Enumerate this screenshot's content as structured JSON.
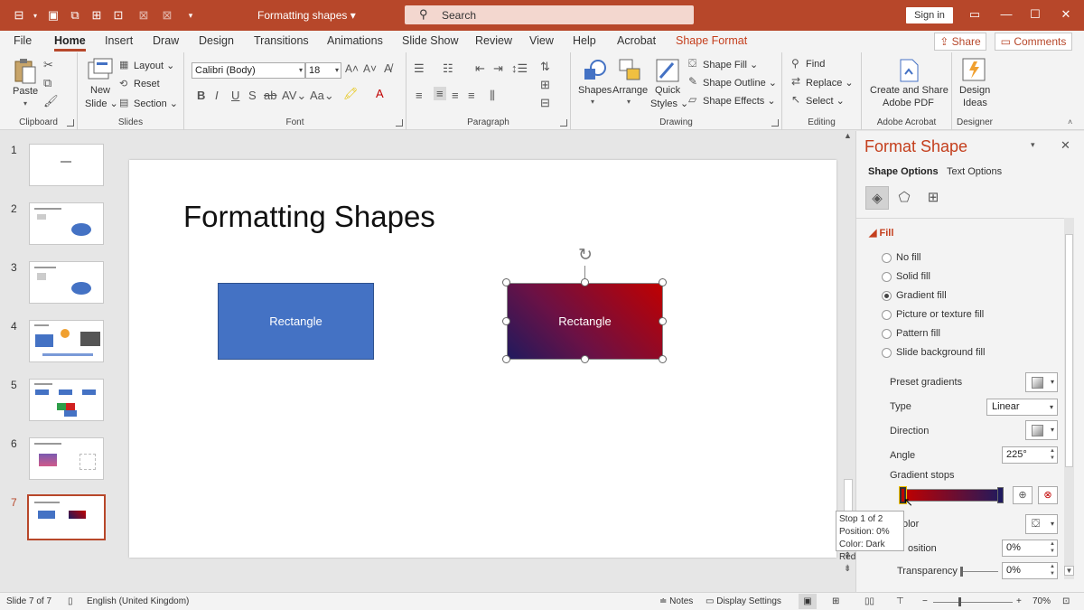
{
  "titlebar": {
    "doc_title": "Formatting shapes ▾",
    "search_label": "Search",
    "signin_label": "Sign in"
  },
  "tabs": [
    "File",
    "Home",
    "Insert",
    "Draw",
    "Design",
    "Transitions",
    "Animations",
    "Slide Show",
    "Review",
    "View",
    "Help",
    "Acrobat",
    "Shape Format"
  ],
  "share_label": "Share",
  "comments_label": "Comments",
  "ribbon": {
    "clipboard": {
      "paste": "Paste",
      "label": "Clipboard"
    },
    "slides": {
      "new_slide_1": "New",
      "new_slide_2": "Slide ⌄",
      "layout": "Layout ⌄",
      "reset": "Reset",
      "section": "Section ⌄",
      "label": "Slides"
    },
    "font": {
      "font_name": "Calibri (Body)",
      "font_size": "18",
      "label": "Font"
    },
    "paragraph": {
      "label": "Paragraph"
    },
    "drawing": {
      "shapes": "Shapes",
      "arrange": "Arrange",
      "quick_styles_1": "Quick",
      "quick_styles_2": "Styles ⌄",
      "shape_fill": "Shape Fill ⌄",
      "shape_outline": "Shape Outline ⌄",
      "shape_effects": "Shape Effects ⌄",
      "label": "Drawing"
    },
    "editing": {
      "find": "Find",
      "replace": "Replace ⌄",
      "select": "Select ⌄",
      "label": "Editing"
    },
    "acrobat": {
      "line1": "Create and Share",
      "line2": "Adobe PDF",
      "label": "Adobe Acrobat"
    },
    "designer": {
      "line1": "Design",
      "line2": "Ideas",
      "label": "Designer"
    }
  },
  "thumbnails": [
    {
      "num": "1"
    },
    {
      "num": "2"
    },
    {
      "num": "3"
    },
    {
      "num": "4"
    },
    {
      "num": "5"
    },
    {
      "num": "6"
    },
    {
      "num": "7"
    }
  ],
  "slide": {
    "title": "Formatting Shapes",
    "rect1_label": "Rectangle",
    "rect2_label": "Rectangle",
    "rect1_color": "#4472c4"
  },
  "format_pane": {
    "title": "Format Shape",
    "tab_shape": "Shape Options",
    "tab_text": "Text Options",
    "fill_header": "Fill",
    "fill_options": [
      {
        "label": "No fill",
        "selected": false
      },
      {
        "label": "Solid fill",
        "selected": false
      },
      {
        "label": "Gradient fill",
        "selected": true
      },
      {
        "label": "Picture or texture fill",
        "selected": false
      },
      {
        "label": "Pattern fill",
        "selected": false
      },
      {
        "label": "Slide background fill",
        "selected": false
      }
    ],
    "preset_gradients": "Preset gradients",
    "type_label": "Type",
    "type_value": "Linear",
    "direction_label": "Direction",
    "angle_label": "Angle",
    "angle_value": "225°",
    "gradient_stops_label": "Gradient stops",
    "color_label": "olor",
    "position_label": "osition",
    "position_value": "0%",
    "transparency_label": "Transparency",
    "transparency_value": "0%"
  },
  "tooltip": {
    "line1": "Stop 1 of 2",
    "line2": "Position: 0%",
    "line3": "Color: Dark Red"
  },
  "statusbar": {
    "slide_count": "Slide 7 of 7",
    "language": "English (United Kingdom)",
    "notes": "Notes",
    "display_settings": "Display Settings",
    "zoom": "70%"
  },
  "colors": {
    "accent": "#b7472a",
    "gradient_start": "#c00000",
    "gradient_end": "#1f1a5e"
  }
}
